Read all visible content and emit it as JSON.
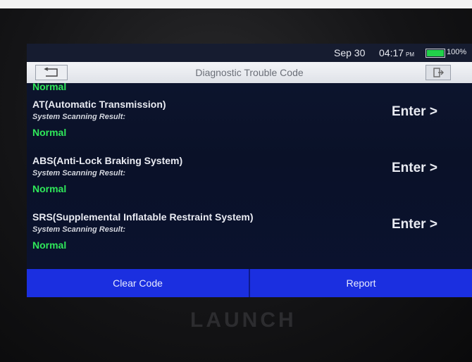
{
  "status": {
    "date": "Sep 30",
    "time": "04:17",
    "ampm": "PM",
    "battery": "100%"
  },
  "header": {
    "title": "Diagnostic Trouble Code",
    "back_icon": "back-arrow-icon",
    "exit_icon": "exit-icon"
  },
  "list": {
    "partial_status": "Normal",
    "items": [
      {
        "name": "AT(Automatic Transmission)",
        "subtitle": "System Scanning Result:",
        "status": "Normal",
        "action": "Enter >"
      },
      {
        "name": "ABS(Anti-Lock Braking System)",
        "subtitle": "System Scanning Result:",
        "status": "Normal",
        "action": "Enter >"
      },
      {
        "name": "SRS(Supplemental Inflatable Restraint System)",
        "subtitle": "System Scanning Result:",
        "status": "Normal",
        "action": "Enter >"
      }
    ]
  },
  "footer": {
    "clear_code": "Clear Code",
    "report": "Report"
  },
  "device": {
    "brand": "LAUNCH"
  },
  "colors": {
    "status_normal": "#2fe85a",
    "footer_button": "#1b2fe0",
    "battery_fill": "#22d14a"
  }
}
